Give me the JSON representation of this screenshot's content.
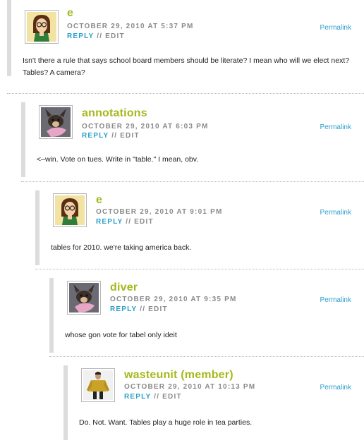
{
  "comments": [
    {
      "author": "e",
      "date": "OCTOBER 29, 2010 AT 5:37 PM",
      "reply_label": "REPLY",
      "separator": "//",
      "edit_label": "EDIT",
      "permalink_label": "Permalink",
      "text": "Isn't there a rule that says school board members should be literate? I mean who will we elect next? Tables? A camera?",
      "avatar_icon": "cartoon-woman-glasses-avatar"
    },
    {
      "author": "annotations",
      "date": "OCTOBER 29, 2010 AT 6:03 PM",
      "reply_label": "REPLY",
      "separator": "//",
      "edit_label": "EDIT",
      "permalink_label": "Permalink",
      "text": "<–win. Vote on tues. Write in \"table.\" I mean, obv.",
      "avatar_icon": "chihuahua-photo-avatar"
    },
    {
      "author": "e",
      "date": "OCTOBER 29, 2010 AT 9:01 PM",
      "reply_label": "REPLY",
      "separator": "//",
      "edit_label": "EDIT",
      "permalink_label": "Permalink",
      "text": "tables for 2010. we're taking america back.",
      "avatar_icon": "cartoon-woman-glasses-avatar"
    },
    {
      "author": "diver",
      "date": "OCTOBER 29, 2010 AT 9:35 PM",
      "reply_label": "REPLY",
      "separator": "//",
      "edit_label": "EDIT",
      "permalink_label": "Permalink",
      "text": "whose gon vote for tabel only ideit",
      "avatar_icon": "chihuahua-photo-avatar"
    },
    {
      "author": "wasteunit (member)",
      "date": "OCTOBER 29, 2010 AT 10:13 PM",
      "reply_label": "REPLY",
      "separator": "//",
      "edit_label": "EDIT",
      "permalink_label": "Permalink",
      "text": "Do. Not. Want. Tables play a huge role in tea parties.",
      "avatar_icon": "gold-jacket-person-avatar"
    }
  ],
  "colors": {
    "author": "#a6b81c",
    "link": "#2b9ec9",
    "meta": "#8a8a8a",
    "bar": "#dcdcdc"
  }
}
